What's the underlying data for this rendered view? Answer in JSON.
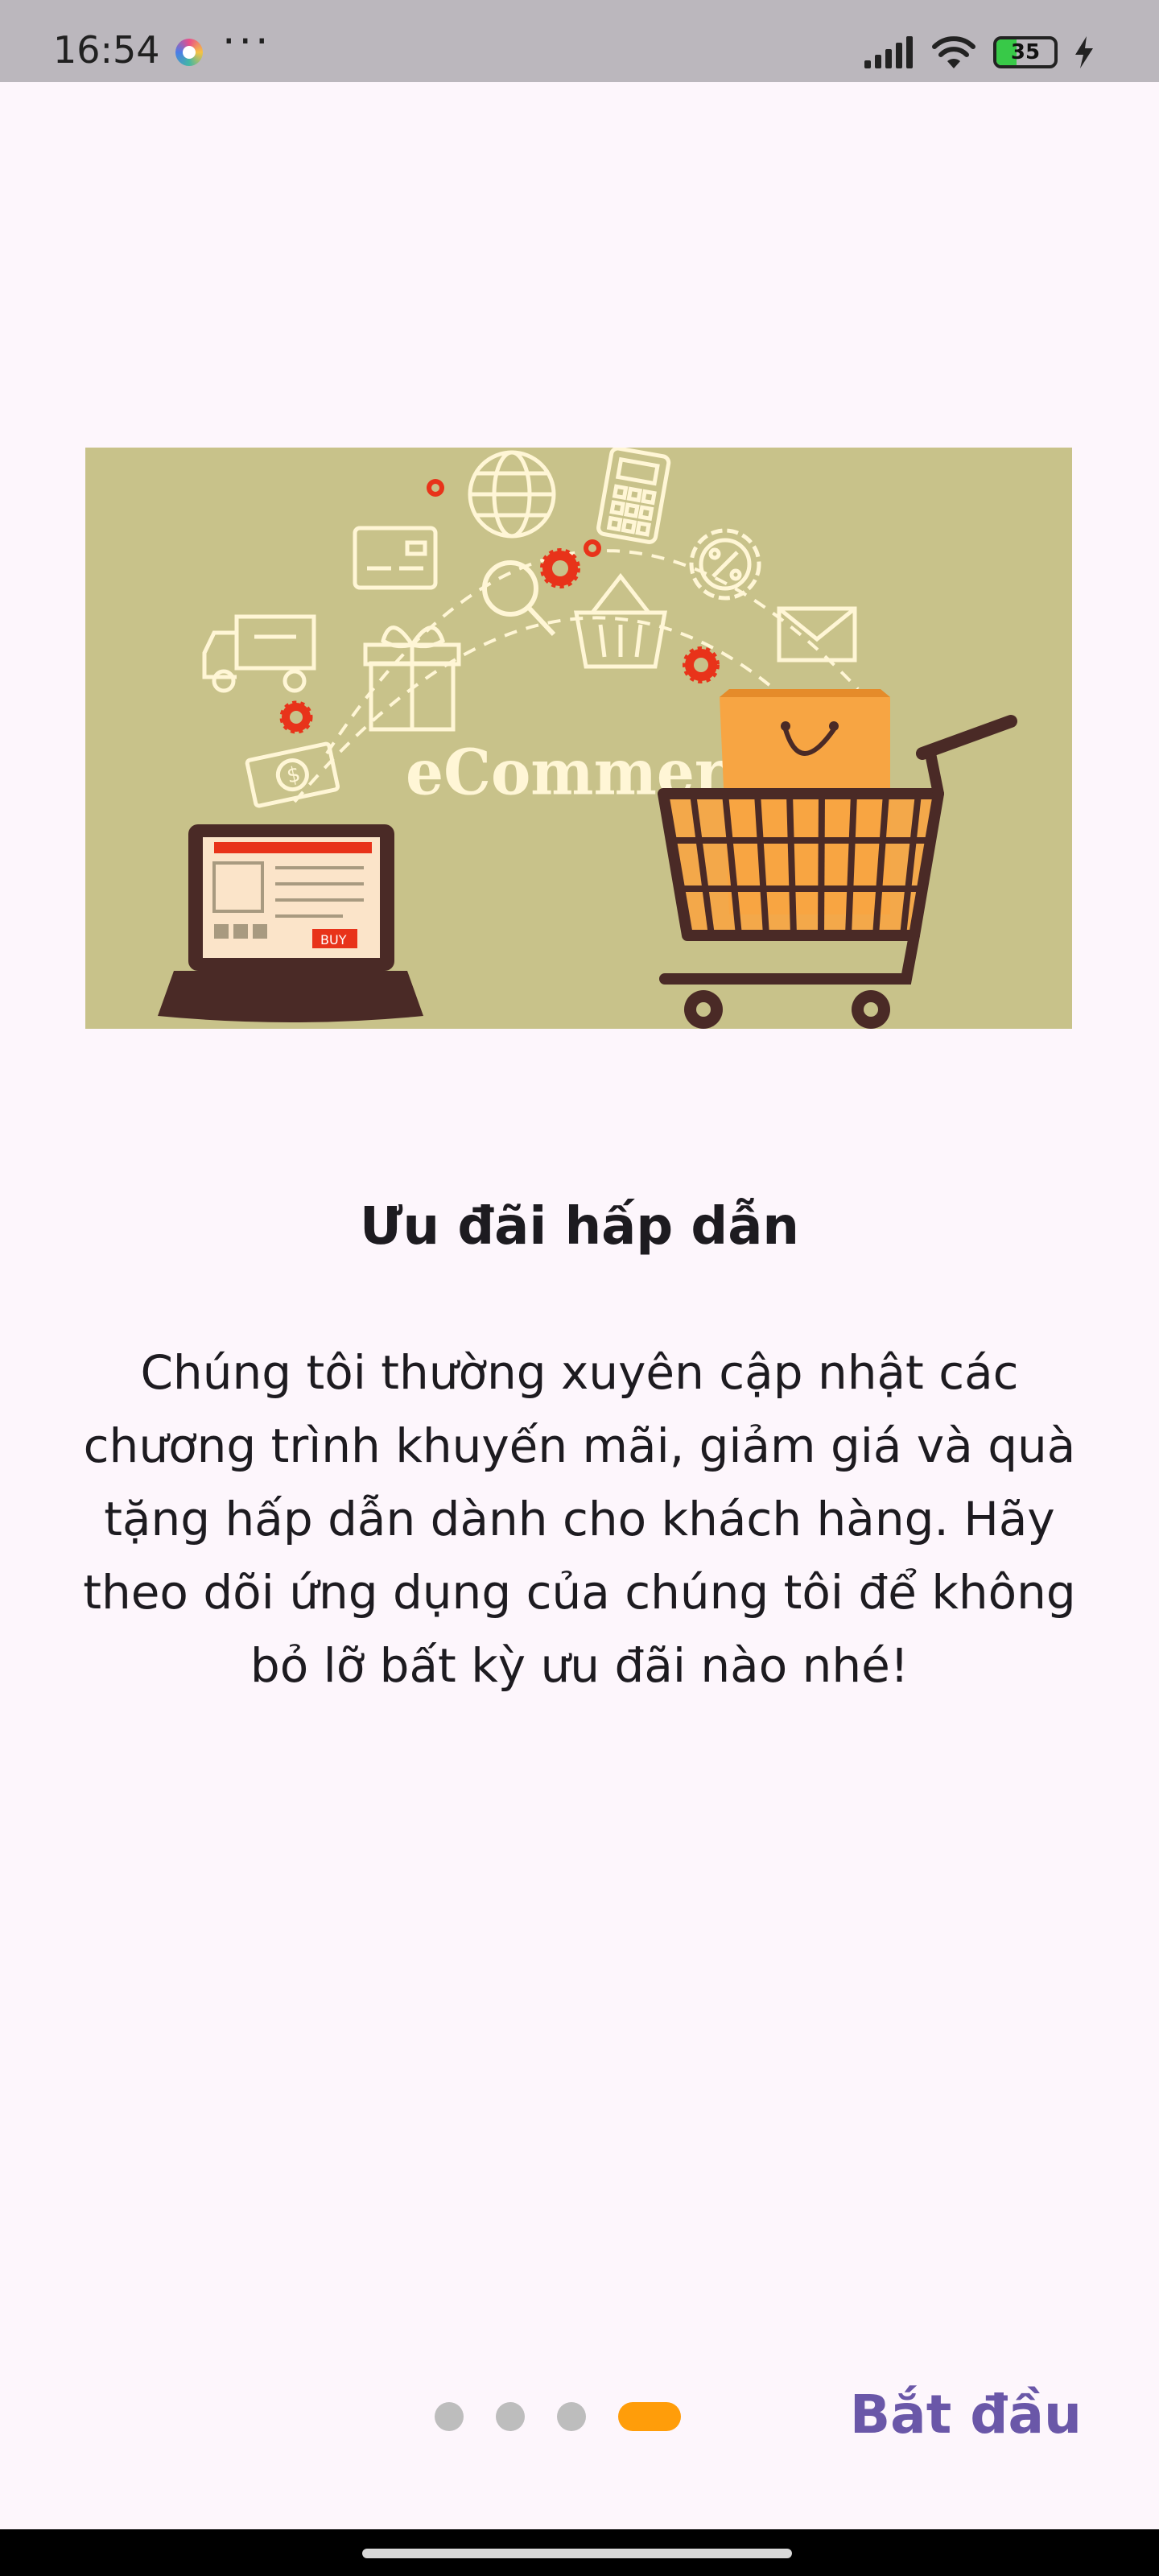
{
  "status_bar": {
    "time": "16:54",
    "more": "···",
    "battery_level": "35",
    "icons": [
      "app-notification-icon",
      "signal-icon",
      "wifi-icon",
      "battery-icon",
      "charging-icon"
    ]
  },
  "hero_image": {
    "brand_text": "eCommerce",
    "buy_label": "BUY",
    "icons": [
      "globe-icon",
      "calculator-icon",
      "credit-card-icon",
      "discount-gear-icon",
      "truck-icon",
      "gift-icon",
      "search-icon",
      "basket-icon",
      "mail-icon",
      "money-icon",
      "laptop-icon",
      "shopping-cart-icon",
      "shopping-bag-icon"
    ],
    "colors": {
      "background": "#c8c28a",
      "line_art": "#fff6d6",
      "accent_red": "#e8331a",
      "cart": "#4a2a26",
      "bag": "#f7a543"
    }
  },
  "onboarding": {
    "title": "Ưu đãi hấp dẫn",
    "description": "Chúng tôi thường xuyên cập nhật các chương trình khuyến mãi, giảm giá và quà tặng hấp dẫn dành cho khách hàng. Hãy theo dõi ứng dụng của chúng tôi để không bỏ lỡ bất kỳ ưu đãi nào nhé!",
    "page_count": 4,
    "current_page": 4,
    "start_label": "Bắt đầu"
  },
  "colors": {
    "accent": "#6a57a8",
    "indicator_active": "#ff9d0a",
    "indicator_inactive": "#bdbdbd",
    "background": "#fdf6fc"
  }
}
